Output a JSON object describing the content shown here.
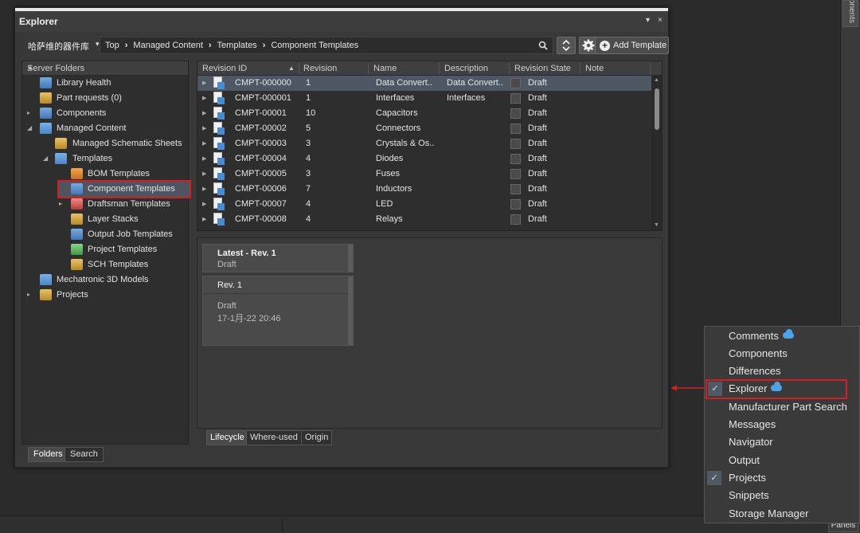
{
  "window": {
    "title": "Explorer",
    "pin_glyph": "▾",
    "close_glyph": "×"
  },
  "nav": {
    "library": "哈萨维的器件库",
    "library_caret": "▾",
    "breadcrumbs": [
      "Top",
      "Managed Content",
      "Templates",
      "Component Templates"
    ],
    "crumb_sep": "›",
    "add_template_label": "Add Template",
    "icons": [
      "search-icon",
      "refresh-icon",
      "gear-icon",
      "add-icon"
    ]
  },
  "folders": {
    "header": "Server Folders",
    "items": [
      {
        "label": "Library Health",
        "icon": "health-icon",
        "level": 1,
        "expander": ""
      },
      {
        "label": "Part requests (0)",
        "icon": "part-request-icon",
        "level": 1,
        "expander": ""
      },
      {
        "label": "Components",
        "icon": "components-icon",
        "level": 1,
        "expander": "▸"
      },
      {
        "label": "Managed Content",
        "icon": "folder-icon",
        "level": 1,
        "expander": "◢"
      },
      {
        "label": "Managed Schematic Sheets",
        "icon": "schematic-sheets-icon",
        "level": 2,
        "expander": ""
      },
      {
        "label": "Templates",
        "icon": "folder-icon",
        "level": 2,
        "expander": "◢"
      },
      {
        "label": "BOM Templates",
        "icon": "bom-icon",
        "level": 3,
        "expander": ""
      },
      {
        "label": "Component Templates",
        "icon": "component-template-icon",
        "level": 3,
        "expander": ""
      },
      {
        "label": "Draftsman Templates",
        "icon": "draftsman-icon",
        "level": 3,
        "expander": "▸"
      },
      {
        "label": "Layer Stacks",
        "icon": "layer-stack-icon",
        "level": 3,
        "expander": ""
      },
      {
        "label": "Output Job Templates",
        "icon": "output-job-icon",
        "level": 3,
        "expander": ""
      },
      {
        "label": "Project Templates",
        "icon": "project-template-icon",
        "level": 3,
        "expander": ""
      },
      {
        "label": "SCH Templates",
        "icon": "sch-template-icon",
        "level": 3,
        "expander": ""
      },
      {
        "label": "Mechatronic 3D Models",
        "icon": "folder-icon",
        "level": 1,
        "expander": ""
      },
      {
        "label": "Projects",
        "icon": "projects-icon",
        "level": 1,
        "expander": "▸"
      }
    ],
    "tabs": [
      "Folders",
      "Search"
    ]
  },
  "grid": {
    "columns": [
      "Revision ID",
      "Revision",
      "Name",
      "Description",
      "Revision State",
      "Note"
    ],
    "sort_glyph": "▲",
    "rows": [
      {
        "id": "CMPT-000000",
        "rev": "1",
        "name": "Data Convert..",
        "desc": "Data Convert..",
        "state": "Draft"
      },
      {
        "id": "CMPT-000001",
        "rev": "1",
        "name": "Interfaces",
        "desc": "Interfaces",
        "state": "Draft"
      },
      {
        "id": "CMPT-00001",
        "rev": "10",
        "name": "Capacitors",
        "desc": "",
        "state": "Draft"
      },
      {
        "id": "CMPT-00002",
        "rev": "5",
        "name": "Connectors",
        "desc": "",
        "state": "Draft"
      },
      {
        "id": "CMPT-00003",
        "rev": "3",
        "name": "Crystals & Os..",
        "desc": "",
        "state": "Draft"
      },
      {
        "id": "CMPT-00004",
        "rev": "4",
        "name": "Diodes",
        "desc": "",
        "state": "Draft"
      },
      {
        "id": "CMPT-00005",
        "rev": "3",
        "name": "Fuses",
        "desc": "",
        "state": "Draft"
      },
      {
        "id": "CMPT-00006",
        "rev": "7",
        "name": "Inductors",
        "desc": "",
        "state": "Draft"
      },
      {
        "id": "CMPT-00007",
        "rev": "4",
        "name": "LED",
        "desc": "",
        "state": "Draft"
      },
      {
        "id": "CMPT-00008",
        "rev": "4",
        "name": "Relays",
        "desc": "",
        "state": "Draft"
      }
    ]
  },
  "detail": {
    "latest": {
      "title": "Latest - Rev.  1",
      "state": "Draft"
    },
    "rev1": {
      "title": "Rev. 1",
      "state": "Draft",
      "timestamp": "17-1月-22 20:46"
    },
    "tabs": [
      "Lifecycle",
      "Where-used",
      "Origin"
    ]
  },
  "panels_menu": {
    "items": [
      {
        "label": "Comments",
        "checked": false,
        "cloud": true
      },
      {
        "label": "Components",
        "checked": false,
        "cloud": false
      },
      {
        "label": "Differences",
        "checked": false,
        "cloud": false
      },
      {
        "label": "Explorer",
        "checked": true,
        "cloud": true
      },
      {
        "label": "Manufacturer Part Search",
        "checked": false,
        "cloud": false
      },
      {
        "label": "Messages",
        "checked": false,
        "cloud": false
      },
      {
        "label": "Navigator",
        "checked": false,
        "cloud": false
      },
      {
        "label": "Output",
        "checked": false,
        "cloud": false
      },
      {
        "label": "Projects",
        "checked": true,
        "cloud": false
      },
      {
        "label": "Snippets",
        "checked": false,
        "cloud": false
      },
      {
        "label": "Storage Manager",
        "checked": false,
        "cloud": false
      }
    ],
    "check_glyph": "✓"
  },
  "right_panel_tab": "onents",
  "panels_button": "Panels",
  "colors": {
    "highlight_red": "#d21f1f",
    "selection": "#4e5864",
    "cloud": "#4aa3e6"
  }
}
